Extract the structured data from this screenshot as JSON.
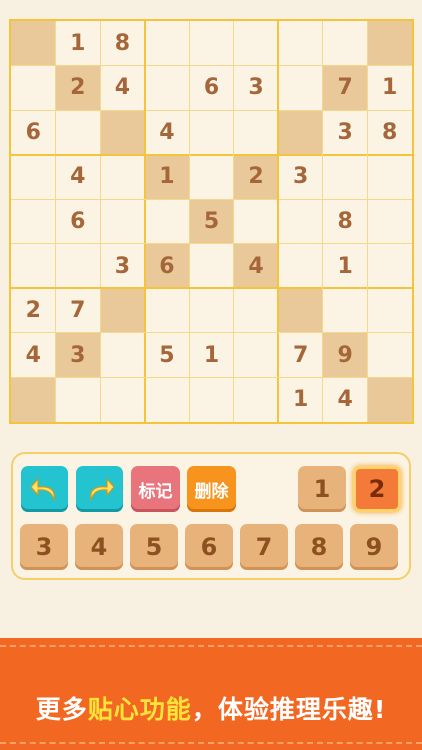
{
  "board": {
    "givens": [
      [
        "",
        "1",
        "8",
        "",
        "",
        "",
        "",
        "",
        ""
      ],
      [
        "",
        "2",
        "4",
        "",
        "6",
        "3",
        "",
        "7",
        "1"
      ],
      [
        "6",
        "",
        "",
        "4",
        "",
        "",
        "",
        "3",
        "8"
      ],
      [
        "",
        "4",
        "",
        "1",
        "",
        "2",
        "3",
        "",
        ""
      ],
      [
        "",
        "6",
        "",
        "",
        "5",
        "",
        "",
        "8",
        ""
      ],
      [
        "",
        "",
        "3",
        "6",
        "",
        "4",
        "",
        "1",
        ""
      ],
      [
        "2",
        "7",
        "",
        "",
        "",
        "",
        "",
        "",
        ""
      ],
      [
        "4",
        "3",
        "",
        "5",
        "1",
        "",
        "7",
        "9",
        ""
      ],
      [
        "",
        "",
        "",
        "",
        "",
        "",
        "1",
        "4",
        ""
      ]
    ],
    "highlighted": [
      [
        0,
        0
      ],
      [
        0,
        8
      ],
      [
        1,
        1
      ],
      [
        1,
        7
      ],
      [
        2,
        2
      ],
      [
        2,
        6
      ],
      [
        3,
        3
      ],
      [
        3,
        5
      ],
      [
        4,
        4
      ],
      [
        5,
        3
      ],
      [
        5,
        5
      ],
      [
        6,
        2
      ],
      [
        6,
        6
      ],
      [
        7,
        1
      ],
      [
        7,
        7
      ],
      [
        8,
        0
      ],
      [
        8,
        8
      ]
    ],
    "colors": {
      "highlight": "#e9c99a",
      "digit": "#a5663a",
      "grid_thick": "#f3c53d",
      "grid_thin": "#f3d989"
    }
  },
  "controls": {
    "undo_icon": "undo-arrow-icon",
    "redo_icon": "redo-arrow-icon",
    "mark_label": "标记",
    "delete_label": "删除",
    "numbers": [
      "1",
      "2",
      "3",
      "4",
      "5",
      "6",
      "7",
      "8",
      "9"
    ],
    "selected_number": "2"
  },
  "banner": {
    "text_before": "更多",
    "text_highlight": "贴心功能",
    "text_after": "，体验推理乐趣!"
  }
}
